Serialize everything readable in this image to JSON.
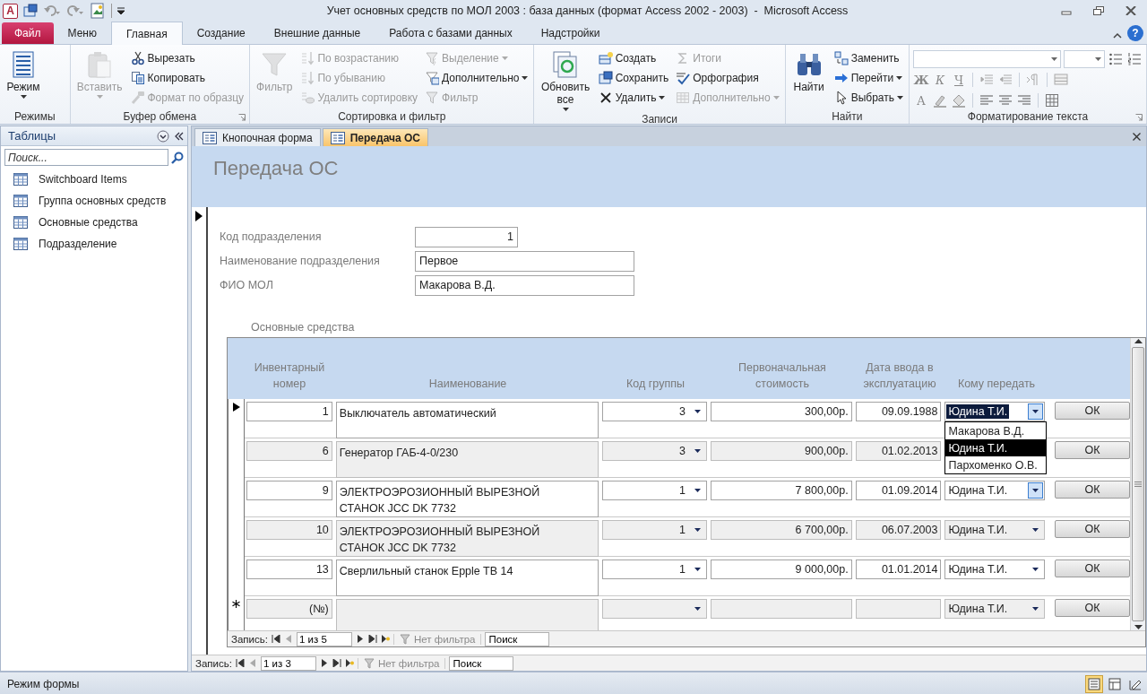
{
  "title_bar": {
    "app_icon": "A",
    "title": "Учет основных средств по МОЛ 2003 : база данных (формат Access 2002 - 2003)  -  Microsoft Access"
  },
  "ribbon_tabs": [
    {
      "label": "Файл",
      "kind": "file",
      "selected": false
    },
    {
      "label": "Меню",
      "kind": "tab",
      "selected": false
    },
    {
      "label": "Главная",
      "kind": "tab",
      "selected": true
    },
    {
      "label": "Создание",
      "kind": "tab",
      "selected": false
    },
    {
      "label": "Внешние данные",
      "kind": "tab",
      "selected": false
    },
    {
      "label": "Работа с базами данных",
      "kind": "tab",
      "selected": false
    },
    {
      "label": "Надстройки",
      "kind": "tab",
      "selected": false
    }
  ],
  "help_button": "?",
  "ribbon_groups": [
    {
      "label": "Режимы",
      "launcher": false,
      "columns": [
        {
          "kind": "large",
          "items": [
            {
              "kind": "view",
              "label": "Режим",
              "disabled": false,
              "dropdown": true
            }
          ]
        }
      ]
    },
    {
      "label": "Буфер обмена",
      "launcher": true,
      "columns": [
        {
          "kind": "large",
          "items": [
            {
              "kind": "paste",
              "label": "Вставить",
              "disabled": true,
              "dropdown": true
            }
          ]
        },
        {
          "kind": "stack",
          "items": [
            {
              "kind": "cut",
              "label": "Вырезать",
              "disabled": false,
              "dropdown": false
            },
            {
              "kind": "copy",
              "label": "Копировать",
              "disabled": false,
              "dropdown": false
            },
            {
              "kind": "brush",
              "label": "Формат по образцу",
              "disabled": true,
              "dropdown": false
            }
          ]
        }
      ]
    },
    {
      "label": "Сортировка и фильтр",
      "launcher": false,
      "columns": [
        {
          "kind": "large",
          "items": [
            {
              "kind": "filter",
              "label": "Фильтр",
              "disabled": true,
              "dropdown": false
            }
          ]
        },
        {
          "kind": "stack",
          "items": [
            {
              "kind": "sort-asc",
              "label": "По возрастанию",
              "disabled": true,
              "dropdown": false
            },
            {
              "kind": "sort-desc",
              "label": "По убыванию",
              "disabled": true,
              "dropdown": false
            },
            {
              "kind": "sort-clear",
              "label": "Удалить сортировку",
              "disabled": true,
              "dropdown": false
            }
          ]
        },
        {
          "kind": "stack",
          "items": [
            {
              "kind": "selection",
              "label": "Выделение",
              "disabled": true,
              "dropdown": true
            },
            {
              "kind": "advanced",
              "label": "Дополнительно",
              "disabled": false,
              "dropdown": true
            },
            {
              "kind": "toggle",
              "label": "Фильтр",
              "disabled": true,
              "dropdown": false
            }
          ]
        }
      ]
    },
    {
      "label": "Записи",
      "launcher": false,
      "columns": [
        {
          "kind": "large",
          "items": [
            {
              "kind": "refresh",
              "label": "Обновить все",
              "disabled": false,
              "dropdown": true
            }
          ]
        },
        {
          "kind": "stack",
          "items": [
            {
              "kind": "new",
              "label": "Создать",
              "disabled": false,
              "dropdown": false
            },
            {
              "kind": "save",
              "label": "Сохранить",
              "disabled": false,
              "dropdown": false
            },
            {
              "kind": "delete",
              "label": "Удалить",
              "disabled": false,
              "dropdown": true
            }
          ]
        },
        {
          "kind": "stack",
          "items": [
            {
              "kind": "totals",
              "label": "Итоги",
              "disabled": true,
              "dropdown": false
            },
            {
              "kind": "spelling",
              "label": "Орфография",
              "disabled": false,
              "dropdown": false
            },
            {
              "kind": "more",
              "label": "Дополнительно",
              "disabled": true,
              "dropdown": true
            }
          ]
        }
      ]
    },
    {
      "label": "Найти",
      "launcher": false,
      "columns": [
        {
          "kind": "large",
          "items": [
            {
              "kind": "find",
              "label": "Найти",
              "disabled": false,
              "dropdown": false
            }
          ]
        },
        {
          "kind": "stack",
          "items": [
            {
              "kind": "replace",
              "label": "Заменить",
              "disabled": false,
              "dropdown": false
            },
            {
              "kind": "goto",
              "label": "Перейти",
              "disabled": false,
              "dropdown": true
            },
            {
              "kind": "select",
              "label": "Выбрать",
              "disabled": false,
              "dropdown": true
            }
          ]
        }
      ]
    }
  ],
  "format_group": {
    "label": "Форматирование текста",
    "launcher": true,
    "rows": [
      [
        {
          "kind": "font-combo"
        },
        {
          "kind": "size-combo"
        },
        {
          "kind": "bullets"
        },
        {
          "kind": "numbering"
        }
      ],
      [
        {
          "kind": "bold",
          "label": "Ж"
        },
        {
          "kind": "italic",
          "label": "К"
        },
        {
          "kind": "underline",
          "label": "Ч"
        },
        {
          "kind": "sep"
        },
        {
          "kind": "indent"
        },
        {
          "kind": "outdent"
        },
        {
          "kind": "sep"
        },
        {
          "kind": "rtl"
        },
        {
          "kind": "sep"
        },
        {
          "kind": "gridlines"
        }
      ],
      [
        {
          "kind": "fontcolor",
          "label": "A"
        },
        {
          "kind": "highlight"
        },
        {
          "kind": "fill"
        },
        {
          "kind": "sep"
        },
        {
          "kind": "align-left"
        },
        {
          "kind": "align-center"
        },
        {
          "kind": "align-right"
        },
        {
          "kind": "sep"
        },
        {
          "kind": "table"
        }
      ]
    ]
  },
  "nav_pane": {
    "title": "Таблицы",
    "search": {
      "placeholder": "Поиск..."
    },
    "items": [
      {
        "label": "Switchboard Items",
        "selected": false
      },
      {
        "label": "Группа основных средств",
        "selected": false
      },
      {
        "label": "Основные средства",
        "selected": false
      },
      {
        "label": "Подразделение",
        "selected": false
      }
    ]
  },
  "doc_tabs": [
    {
      "label": "Кнопочная форма",
      "selected": false
    },
    {
      "label": "Передача ОС",
      "selected": true
    }
  ],
  "form": {
    "title": "Передача ОС",
    "fields": [
      {
        "kind": "number",
        "label": "Код подразделения",
        "value": "1"
      },
      {
        "kind": "text",
        "label": "Наименование подразделения",
        "value": "Первое"
      },
      {
        "kind": "text",
        "label": "ФИО МОЛ",
        "value": "Макарова В.Д."
      }
    ],
    "subform": {
      "label": "Основные средства",
      "columns": [
        "Инвентарный номер",
        "Наименование",
        "Код группы",
        "Первоначальная стоимость",
        "Дата ввода в эксплуатацию",
        "Кому передать"
      ],
      "rows": [
        {
          "kind": "record",
          "selected": true,
          "inventory": "1",
          "name": "Выключатель автоматический",
          "group": "3",
          "cost": "300,00р.",
          "date": "09.09.1988",
          "recipient": {
            "value": "Юдина Т.И.",
            "focused": true,
            "arrow_hot": true,
            "open": true,
            "options": [
              {
                "label": "Макарова В.Д.",
                "selected": false
              },
              {
                "label": "Юдина Т.И.",
                "selected": true
              },
              {
                "label": "Пархоменко О.В.",
                "selected": false
              }
            ]
          },
          "button": "ОК"
        },
        {
          "kind": "record",
          "selected": false,
          "inventory": "6",
          "name": "Генератор ГАБ-4-0/230",
          "group": "3",
          "cost": "900,00р.",
          "date": "01.02.2013",
          "button": "ОК"
        },
        {
          "kind": "record",
          "selected": false,
          "inventory": "9",
          "name": "ЭЛЕКТРОЭРОЗИОННЫЙ ВЫРЕЗНОЙ СТАНОК JCC DK 7732",
          "group": "1",
          "cost": "7 800,00р.",
          "date": "01.09.2014",
          "recipient": {
            "value": "Юдина Т.И.",
            "focused": false,
            "arrow_hot": true,
            "open": false
          },
          "button": "ОК"
        },
        {
          "kind": "record",
          "selected": false,
          "inventory": "10",
          "name": "ЭЛЕКТРОЭРОЗИОННЫЙ ВЫРЕЗНОЙ СТАНОК JCC DK 7732",
          "group": "1",
          "cost": "6 700,00р.",
          "date": "06.07.2003",
          "recipient": {
            "value": "Юдина Т.И.",
            "focused": false,
            "arrow_hot": false,
            "open": false
          },
          "button": "ОК"
        },
        {
          "kind": "record",
          "selected": false,
          "inventory": "13",
          "name": "Сверлильный станок Epple TB 14",
          "group": "1",
          "cost": "9 000,00р.",
          "date": "01.01.2014",
          "recipient": {
            "value": "Юдина Т.И.",
            "focused": false,
            "arrow_hot": false,
            "open": false
          },
          "button": "ОК"
        },
        {
          "kind": "new",
          "selected": false,
          "inventory": "(№)",
          "recipient": {
            "value": "Юдина Т.И.",
            "focused": false,
            "arrow_hot": false,
            "open": false
          },
          "button": "ОК"
        }
      ],
      "navigator": {
        "label": "Запись:",
        "position": "1 из 5",
        "filter": "Нет фильтра",
        "search_placeholder": "Поиск"
      }
    },
    "navigator": {
      "label": "Запись:",
      "position": "1 из 3",
      "filter": "Нет фильтра",
      "search_placeholder": "Поиск"
    }
  },
  "status_bar": {
    "text": "Режим формы",
    "views": [
      {
        "kind": "form",
        "selected": true
      },
      {
        "kind": "layout",
        "selected": false
      },
      {
        "kind": "design",
        "selected": false
      }
    ]
  }
}
